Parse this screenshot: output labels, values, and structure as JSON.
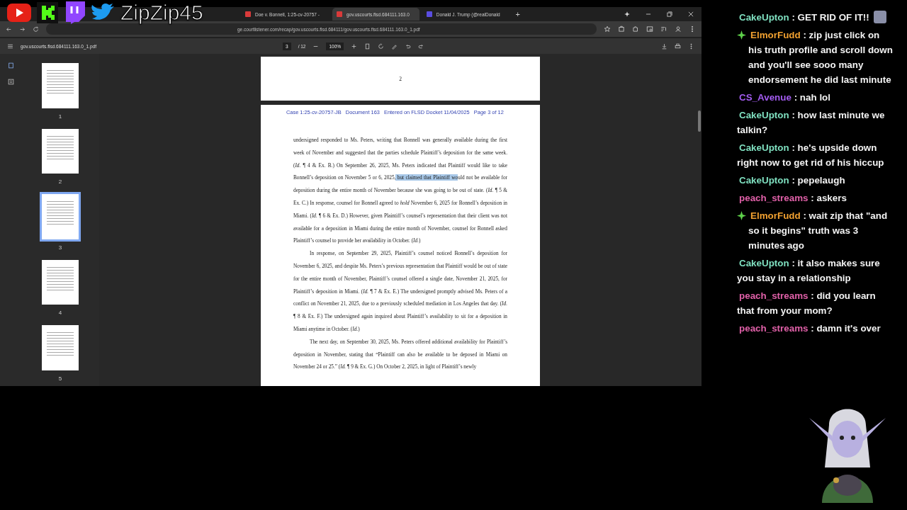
{
  "overlay": {
    "channel_name": "ZipZip45"
  },
  "browser": {
    "tabs": [
      {
        "title": "Doe v. Bonnell, 1:25-cv-20757 -",
        "kind": "pdf",
        "selected": false
      },
      {
        "title": "gov.uscourts.flsd.684111.163.0",
        "kind": "pdf",
        "selected": true
      },
      {
        "title": "Donald J. Trump (@realDonald",
        "kind": "social",
        "selected": false
      }
    ],
    "new_tab": "+",
    "url": "ge.courtlistener.com/recap/gov.uscourts.flsd.684111/gov.uscourts.flsd.684111.163.0_1.pdf"
  },
  "pdf_viewer": {
    "filename": "gov.uscourts.flsd.684111.163.0_1.pdf",
    "page_input": "3",
    "page_total": "/ 12",
    "zoom": "100%",
    "thumbnails": [
      {
        "label": "1",
        "selected": false
      },
      {
        "label": "2",
        "selected": false
      },
      {
        "label": "3",
        "selected": true
      },
      {
        "label": "4",
        "selected": false
      },
      {
        "label": "5",
        "selected": false
      }
    ],
    "previous_page_number": "2",
    "page_header": "Case 1:25-cv-20757-JB   Document 163   Entered on FLSD Docket 11/04/2025   Page 3 of 12",
    "paragraphs": [
      {
        "indent": false,
        "segments": [
          {
            "text": "undersigned responded to Ms. Peters, writing that Bonnell was generally available during the first week of November and suggested that the parties schedule Plaintiff’s deposition for the same week. (*Id.* ¶ 4 & Ex. B.) On September 26, 2025, Ms. Peters indicated that Plaintiff would like to take Bonnell’s deposition on November 5 or 6, 2025,",
            "highlighted": false
          },
          {
            "text": " but claimed that Plaintiff wo",
            "highlighted": true
          },
          {
            "text": "uld not be available for deposition during the entire month of November because she was going to be out of state. (*Id.* ¶ 5 & Ex. C.) In response, counsel for Bonnell agreed to *hold* November 6, 2025 for Bonnell’s deposition in Miami. (*Id.* ¶ 6 & Ex. D.) However, given Plaintiff’s counsel’s representation that their client was not available for a deposition in Miami during the entire month of November, counsel for Bonnell asked Plaintiff’s counsel to provide her availability in October. (*Id.*)",
            "highlighted": false
          }
        ]
      },
      {
        "indent": true,
        "segments": [
          {
            "text": "In response, on September 29, 2025, Plaintiff’s counsel noticed Bonnell’s deposition for November 6, 2025, and despite Ms. Peters’s previous representation that Plaintiff would be out of state for the entire month of November, Plaintiff’s counsel offered a single date, November 21, 2025, for Plaintiff’s deposition in Miami. (*Id.* ¶ 7 & Ex. E.) The undersigned promptly advised Ms. Peters of a conflict on November 21, 2025, due to a previously scheduled mediation in Los Angeles that day. (*Id.* ¶ 8 & Ex. F.) The undersigned again inquired about Plaintiff’s availability to sit for a deposition in Miami anytime in October. (*Id.*)",
            "highlighted": false
          }
        ]
      },
      {
        "indent": true,
        "segments": [
          {
            "text": "The next day, on September 30, 2025, Ms. Peters offered additional availability for Plaintiff’s deposition in November, stating that “Plaintiff can also be available to be deposed in Miami on November 24 or 25.” (*Id.* ¶ 9 & Ex. G.) On October 2, 2025, in light of Plaintiff’s newly",
            "highlighted": false
          }
        ]
      }
    ]
  },
  "chat": [
    {
      "user": "CakeUpton",
      "color": "#7fe0c0",
      "badge": false,
      "emote": true,
      "text": ": GET RID OF IT!!"
    },
    {
      "user": "ElmorFudd",
      "color": "#f0a030",
      "badge": true,
      "emote": false,
      "text": ": zip just click on his truth profile and scroll down and you'll see sooo many endorsement he did last minute"
    },
    {
      "user": "CS_Avenue",
      "color": "#a35cf0",
      "badge": false,
      "emote": false,
      "text": ": nah lol"
    },
    {
      "user": "CakeUpton",
      "color": "#7fe0c0",
      "badge": false,
      "emote": false,
      "text": ": how last minute we talkin?"
    },
    {
      "user": "CakeUpton",
      "color": "#7fe0c0",
      "badge": false,
      "emote": false,
      "text": ": he's upside down right now to get rid of his hiccup"
    },
    {
      "user": "CakeUpton",
      "color": "#7fe0c0",
      "badge": false,
      "emote": false,
      "text": ": pepelaugh"
    },
    {
      "user": "peach_streams",
      "color": "#e060a8",
      "badge": false,
      "emote": false,
      "text": ": askers"
    },
    {
      "user": "ElmorFudd",
      "color": "#f0a030",
      "badge": true,
      "emote": false,
      "text": ": wait zip that \"and so it begins\" truth was 3 minutes ago"
    },
    {
      "user": "CakeUpton",
      "color": "#7fe0c0",
      "badge": false,
      "emote": false,
      "text": ": it also makes sure you stay in a relationship"
    },
    {
      "user": "peach_streams",
      "color": "#e060a8",
      "badge": false,
      "emote": false,
      "text": ": did you learn that from your mom?"
    },
    {
      "user": "peach_streams",
      "color": "#e060a8",
      "badge": false,
      "emote": false,
      "text": ": damn it's over"
    }
  ]
}
